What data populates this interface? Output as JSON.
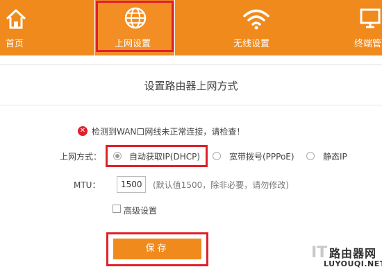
{
  "nav": {
    "home": "首页",
    "internet": "上网设置",
    "wireless": "无线设置",
    "devices": "终端管理"
  },
  "page_title": "设置路由器上网方式",
  "alert": {
    "text": "检测到WAN口网线未正常连接，请检查！",
    "icon": "error-icon"
  },
  "connection": {
    "label": "上网方式：",
    "options": [
      "自动获取IP(DHCP)",
      "宽带拨号(PPPoE)",
      "静态IP"
    ],
    "selected": "自动获取IP(DHCP)"
  },
  "mtu": {
    "label": "MTU：",
    "value": "1500",
    "hint": "(默认值1500，除非必要，请勿修改)"
  },
  "advanced": {
    "label": "高级设置",
    "checked": false
  },
  "save_label": "保存",
  "watermark": {
    "it": "IT",
    "cn": "路由器网",
    "url": "LUYOUQI.NET"
  },
  "colors": {
    "brand": "#f08a1c",
    "highlight": "#e0202a"
  }
}
